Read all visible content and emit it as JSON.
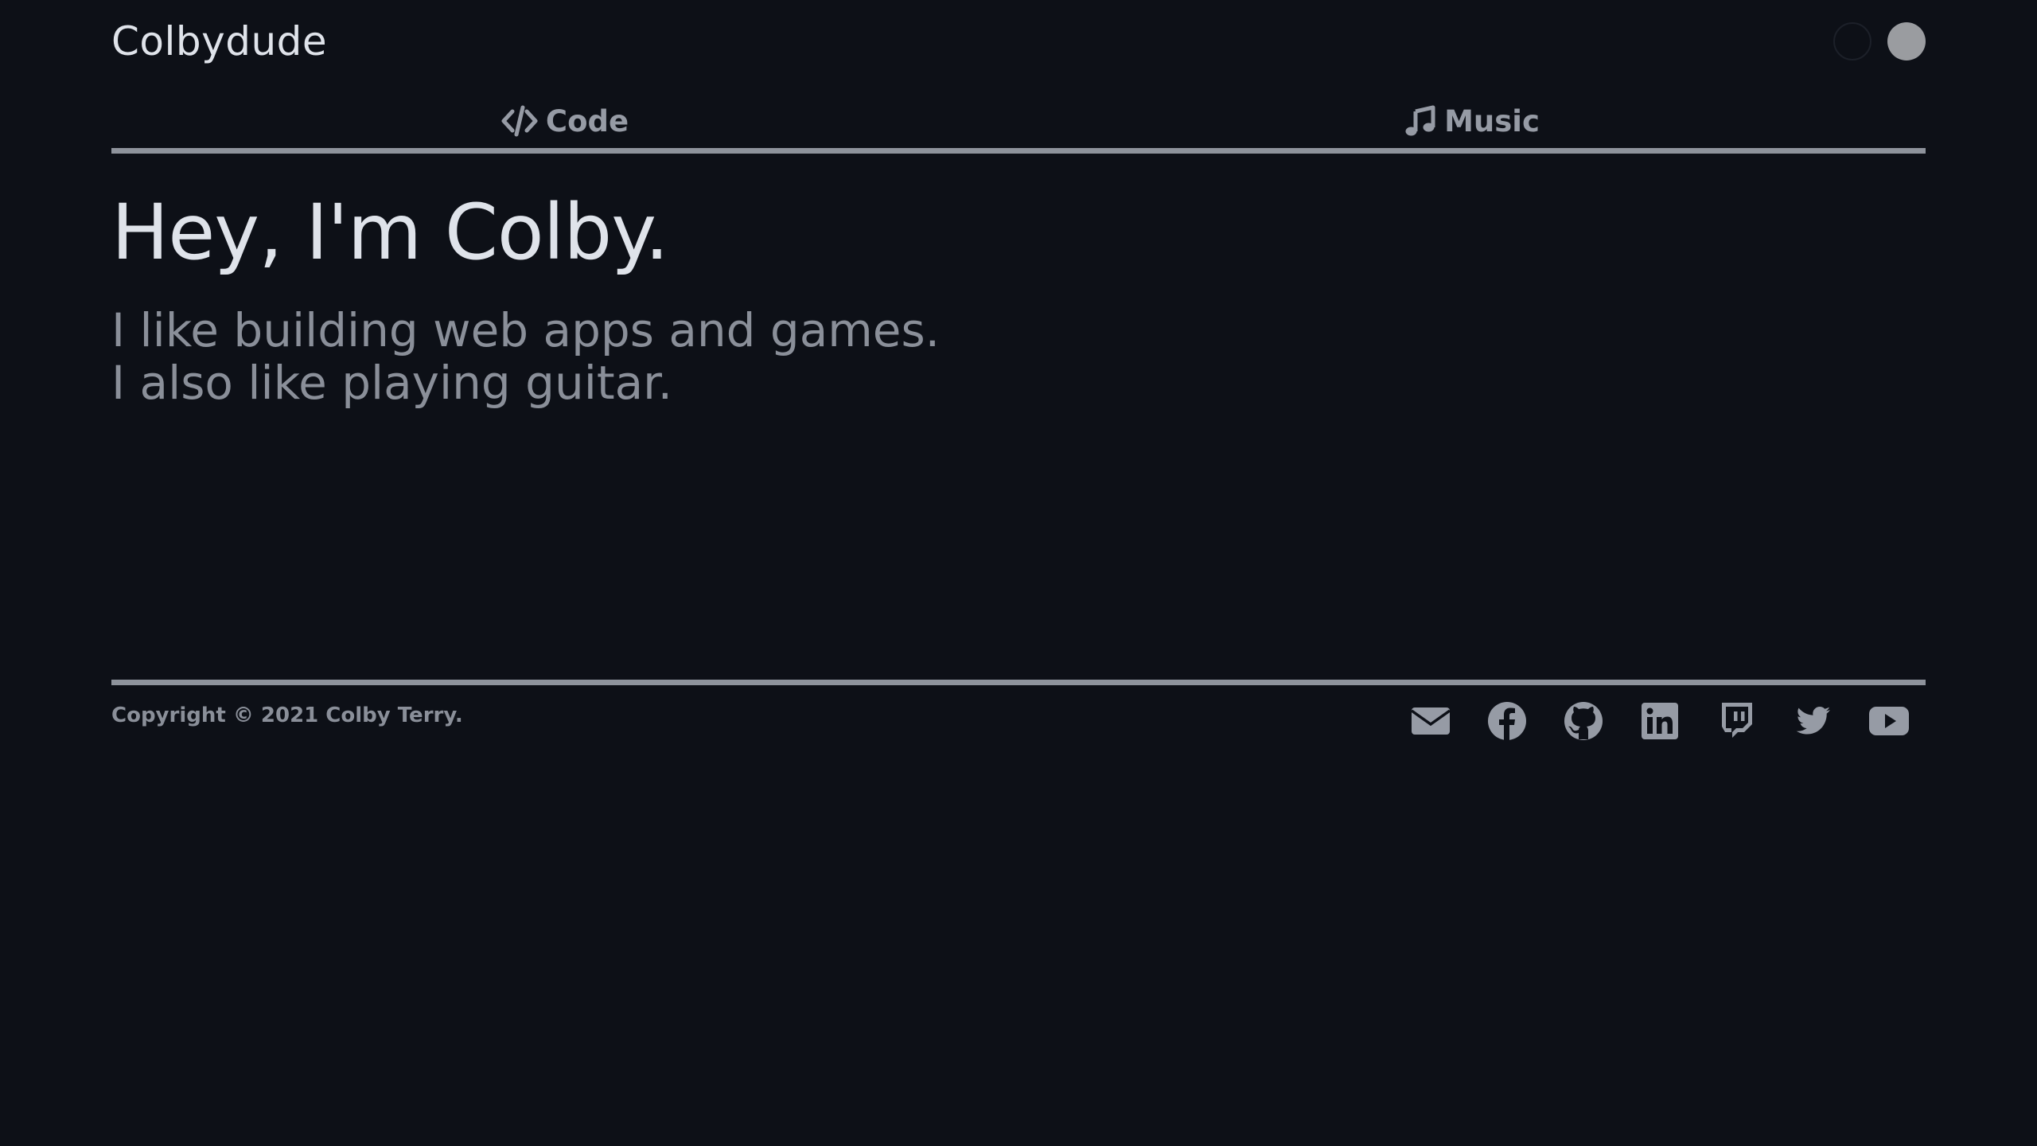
{
  "header": {
    "brand": "Colbydude",
    "theme_options": [
      "dark",
      "light"
    ]
  },
  "nav": {
    "items": [
      {
        "label": "Code",
        "icon": "code-icon"
      },
      {
        "label": "Music",
        "icon": "music-note-icon"
      }
    ]
  },
  "hero": {
    "title": "Hey, I'm Colby.",
    "line1": "I like building web apps and games.",
    "line2": "I also like playing guitar."
  },
  "footer": {
    "copyright": "Copyright © 2021 Colby Terry.",
    "socials": [
      "envelope-icon",
      "facebook-icon",
      "github-icon",
      "linkedin-icon",
      "twitch-icon",
      "twitter-icon",
      "youtube-icon"
    ]
  },
  "colors": {
    "background": "#0d1017",
    "text_primary": "#dfe3ea",
    "text_muted": "#8a8f99",
    "rule": "#8e939c"
  }
}
